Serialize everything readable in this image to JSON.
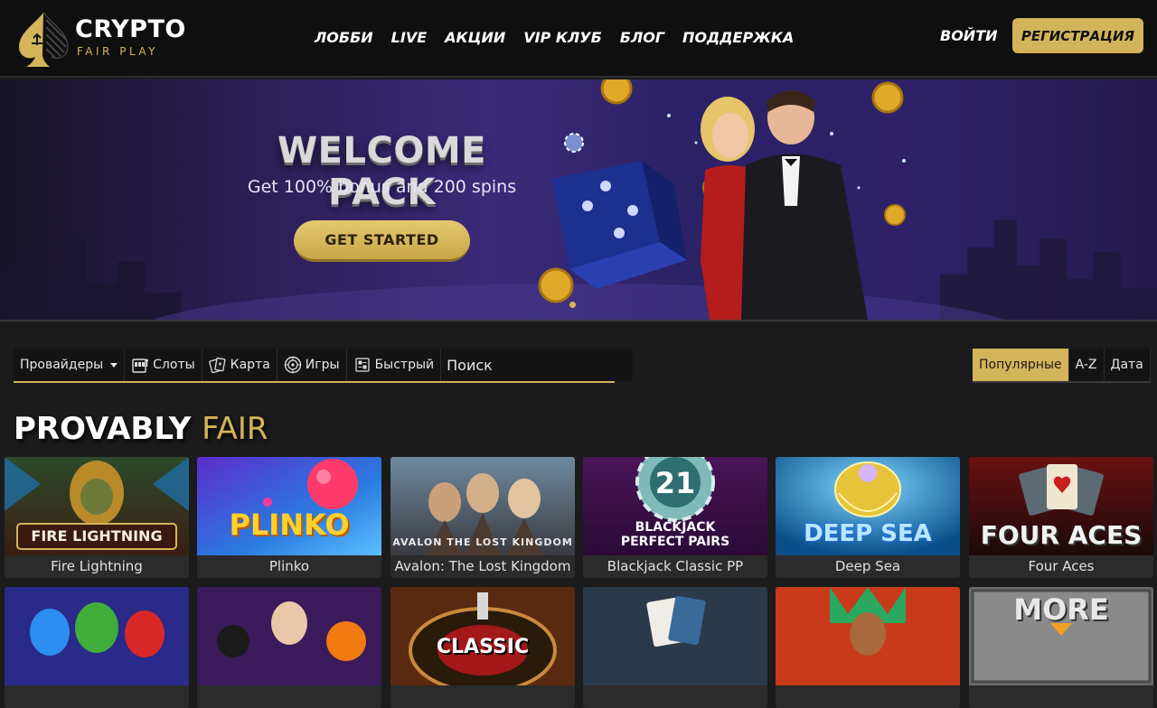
{
  "header": {
    "logo_title": "CRYPTO",
    "logo_sub": "FAIR PLAY",
    "nav": [
      "ЛОББИ",
      "LIVE",
      "АКЦИИ",
      "VIP КЛУБ",
      "БЛОГ",
      "ПОДДЕРЖКА"
    ],
    "login_label": "ВОЙТИ",
    "register_label": "РЕГИСТРАЦИЯ"
  },
  "banner": {
    "title": "WELCOME PACK",
    "subtitle": "Get 100% bonus and 200 spins",
    "cta": "GET STARTED"
  },
  "filters": {
    "providers_label": "Провайдеры",
    "items": [
      {
        "label": "Слоты",
        "icon": "slot-machine-icon"
      },
      {
        "label": "Карта",
        "icon": "cards-icon"
      },
      {
        "label": "Игры",
        "icon": "roulette-icon"
      },
      {
        "label": "Быстрый",
        "icon": "fast-game-icon"
      }
    ],
    "search_placeholder": "Поиск"
  },
  "sort": {
    "items": [
      "Популярные",
      "A-Z",
      "Дата"
    ],
    "active": "Популярные"
  },
  "section": {
    "title_main": "PROVABLY",
    "title_accent": "FAIR"
  },
  "games_row1": [
    {
      "name": "Fire Lightning",
      "art": "FIRE LIGHTNING"
    },
    {
      "name": "Plinko",
      "art": "PLINKO"
    },
    {
      "name": "Avalon: The Lost Kingdom",
      "art": "AVALON THE LOST KINGDOM"
    },
    {
      "name": "Blackjack Classic PP",
      "art": "BLACKJACK PERFECT PAIRS"
    },
    {
      "name": "Deep Sea",
      "art": "DEEP SEA"
    },
    {
      "name": "Four Aces",
      "art": "FOUR ACES"
    }
  ],
  "games_row2": [
    {
      "art": ""
    },
    {
      "art": ""
    },
    {
      "art": "CLASSIC"
    },
    {
      "art": ""
    },
    {
      "art": ""
    },
    {
      "art": "MORE"
    }
  ],
  "colors": {
    "accent": "#d3b45a",
    "header_bg": "#0f0f0f",
    "page_bg": "#1b1b1b"
  }
}
